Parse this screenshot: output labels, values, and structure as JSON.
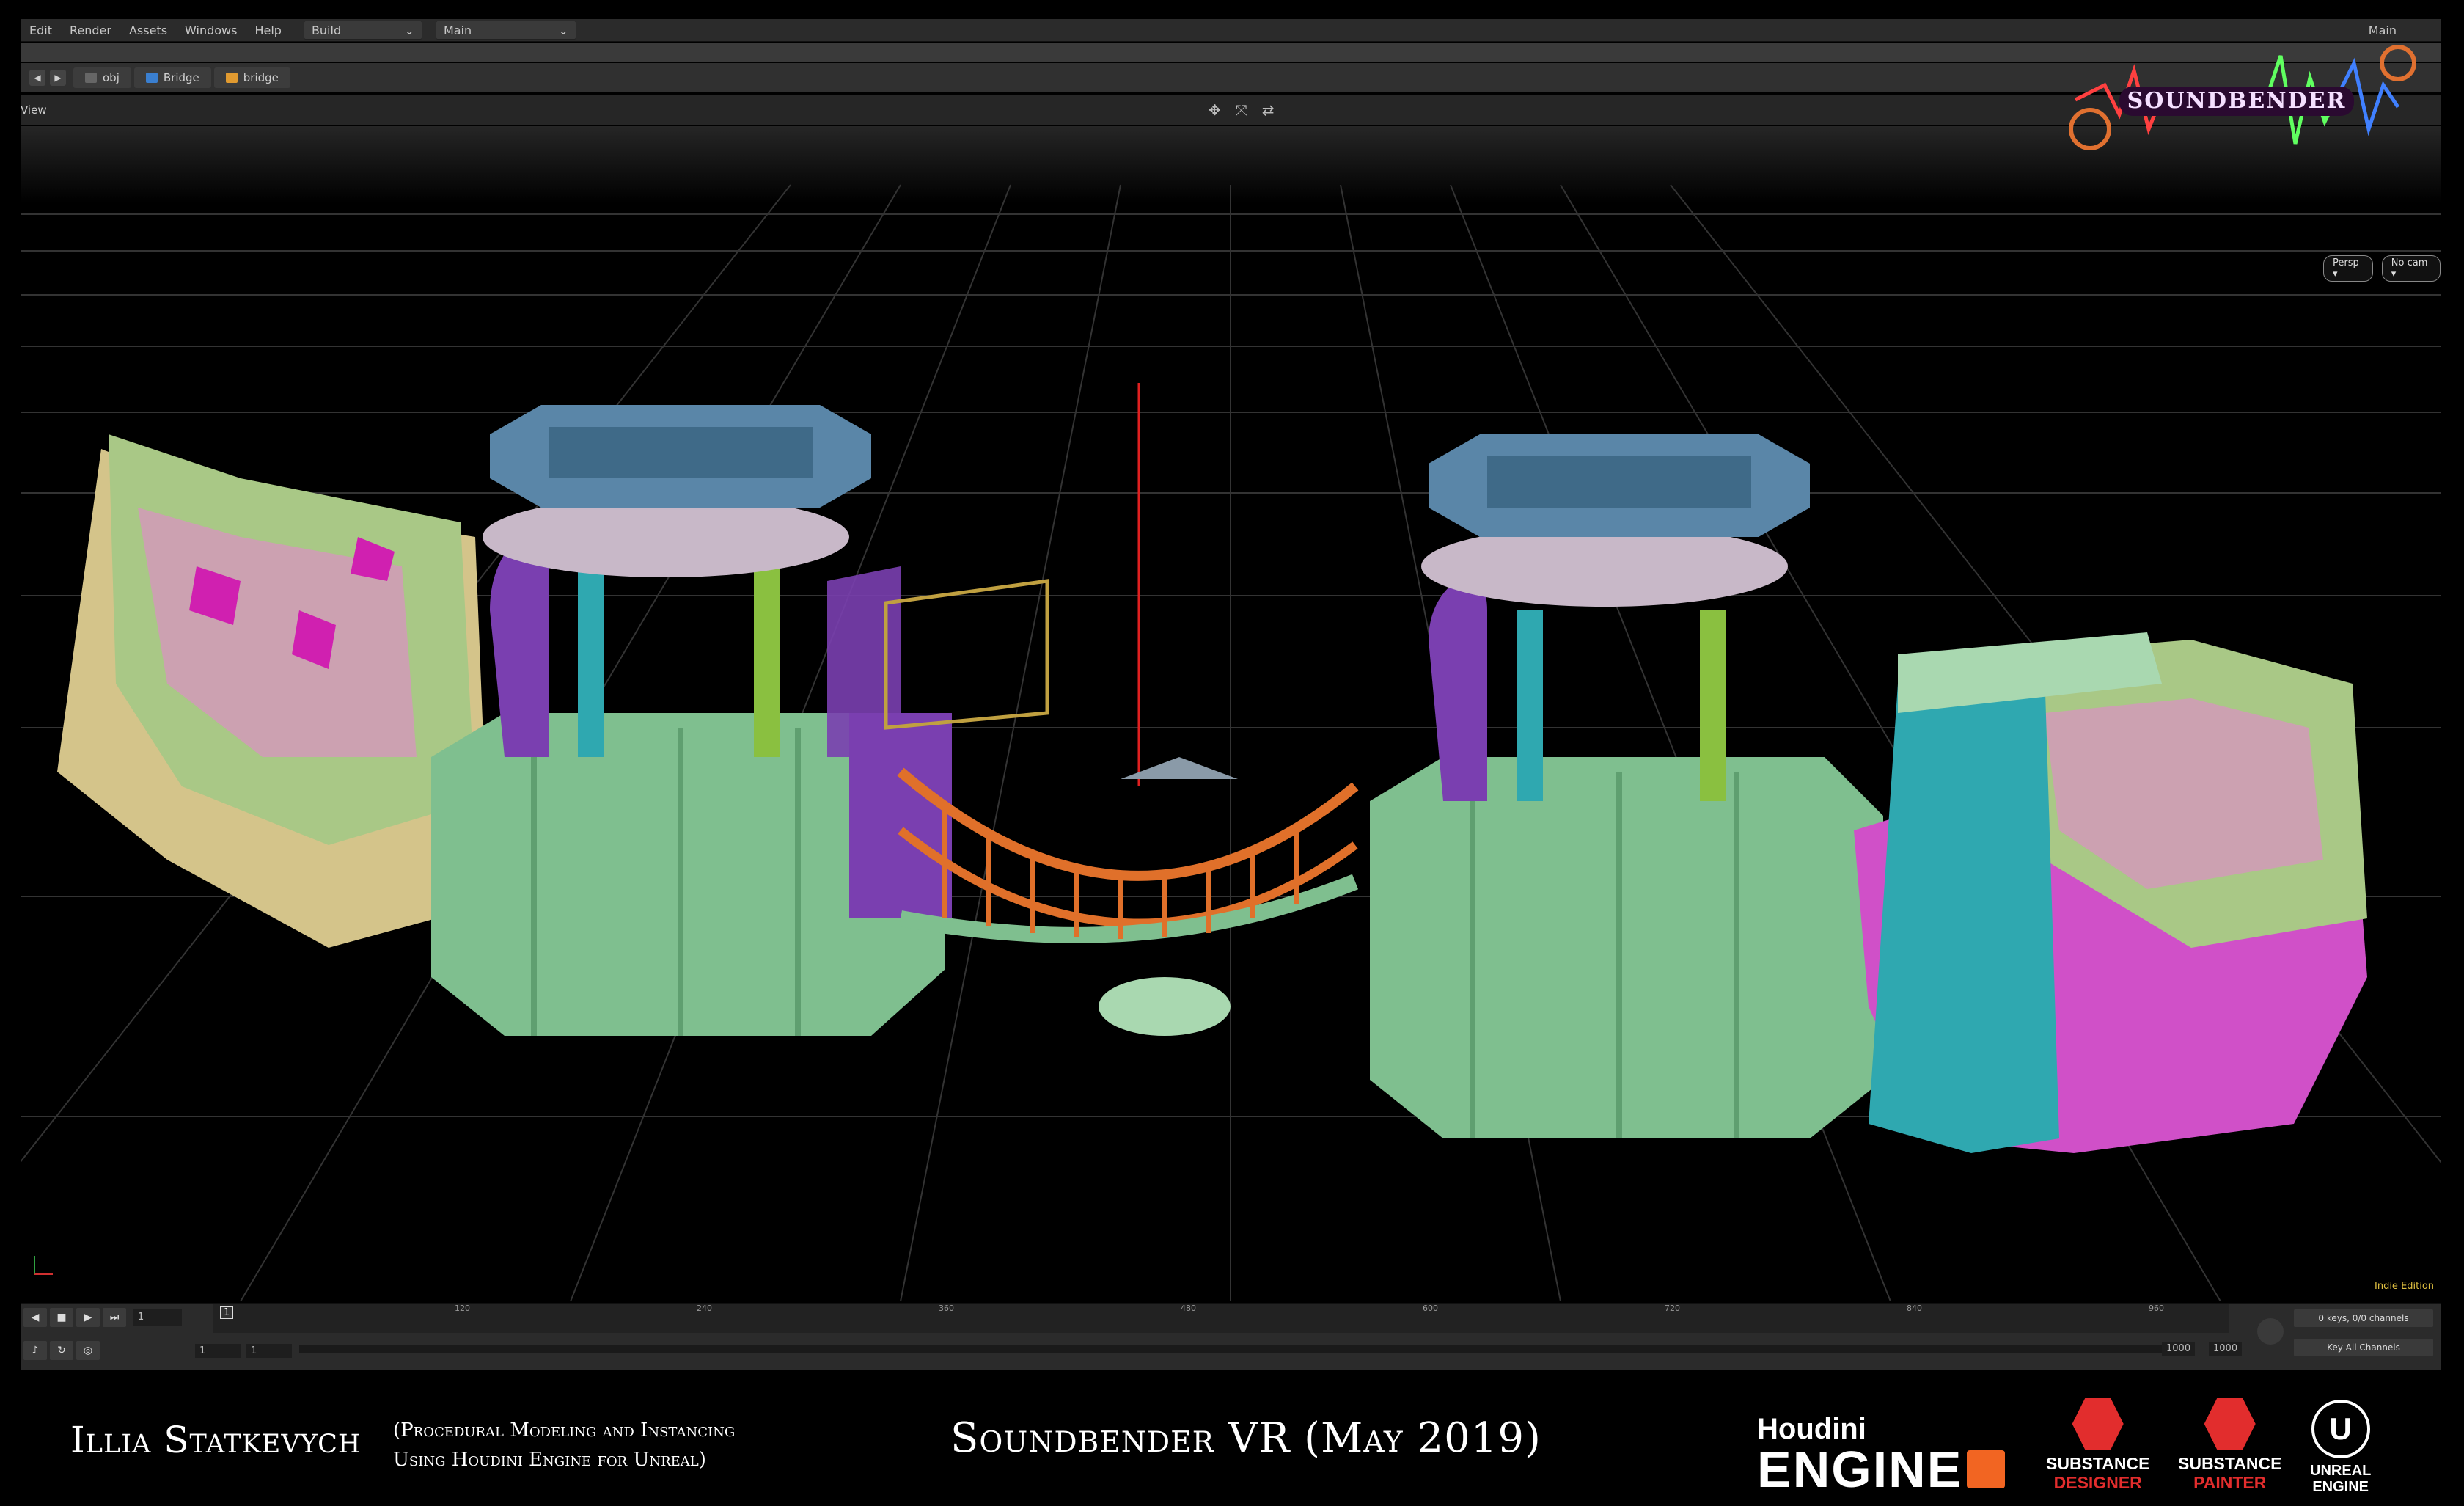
{
  "menu": {
    "items": [
      "Edit",
      "Render",
      "Assets",
      "Windows",
      "Help"
    ],
    "desktop_build": "Build",
    "desktop_main": "Main",
    "right_main": "Main"
  },
  "path": {
    "crumbs": [
      "obj",
      "Bridge",
      "bridge"
    ]
  },
  "view": {
    "label": "View",
    "persp": "Persp ▾",
    "camera": "No cam ▾",
    "edition": "Indie Edition"
  },
  "logo": {
    "text": "SOUNDBENDER"
  },
  "timeline": {
    "frame": "1",
    "marker": "1",
    "ticks": [
      "120",
      "240",
      "360",
      "480",
      "600",
      "720",
      "840",
      "960"
    ],
    "range_start": "1",
    "range_start2": "1",
    "range_end": "1000",
    "range_end2": "1000",
    "keys_label": "0 keys, 0/0 channels",
    "key_all": "Key All Channels"
  },
  "credits": {
    "author": "Illia Statkevych",
    "subtitle_line1": "(Procedural Modeling and Instancing",
    "subtitle_line2": "Using Houdini Engine for Unreal)",
    "project": "Soundbender VR (May 2019)",
    "houdini_top": "Houdini",
    "houdini_bottom": "ENGINE",
    "designer_top": "SUBSTANCE",
    "designer_bottom": "DESIGNER",
    "painter_top": "SUBSTANCE",
    "painter_bottom": "PAINTER",
    "unreal_top": "UNREAL",
    "unreal_bottom": "ENGINE"
  },
  "colors": {
    "ground": "#7fbf8f",
    "roof": "#5a86a8",
    "purple": "#7a3fb0",
    "orange": "#e0702a",
    "magenta": "#d050c8",
    "teal": "#2fa8b0",
    "sand": "#d4c48a"
  }
}
